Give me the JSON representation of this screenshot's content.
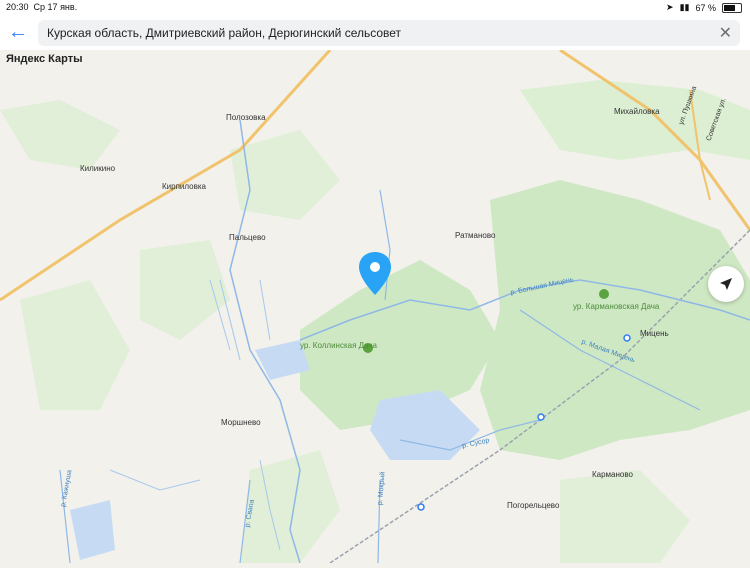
{
  "status_bar": {
    "time": "20:30",
    "date": "Ср 17 янв.",
    "battery": "67 %"
  },
  "search": {
    "query": "Курская область, Дмитриевский район, Дерюгинский сельсовет"
  },
  "map": {
    "provider_logo": "Яндекс Карты",
    "places": [
      "Полозовка",
      "Киликино",
      "Кирпиловка",
      "Пальцево",
      "Ратманово",
      "Михайловка",
      "Мицень",
      "Моршнево",
      "Карманово",
      "Погорельцево"
    ],
    "nature": [
      "ур. Коллинская Дача",
      "ур. Кармановская Дача"
    ],
    "rivers": [
      "р. Большая Мицень",
      "р. Малая Мицень",
      "р. Сусор",
      "р. Свапа",
      "р. Мокрый",
      "р. Кажнуша"
    ],
    "streets": [
      "ул. Пушкина",
      "Советская ул."
    ]
  },
  "colors": {
    "accent": "#2f7cf6",
    "forest": "#cfe8c4",
    "water": "#c6dbf3",
    "road": "#f0c36c",
    "pin": "#28a3f5"
  }
}
